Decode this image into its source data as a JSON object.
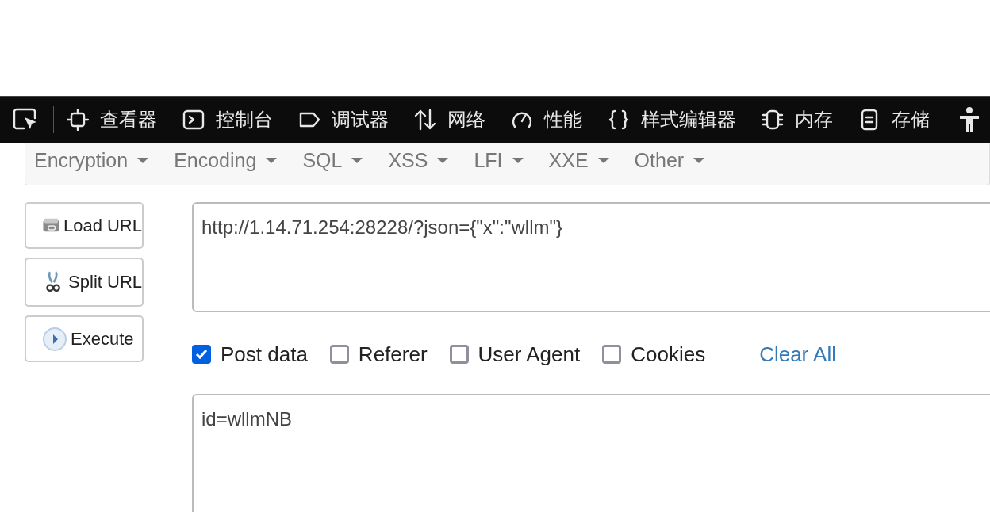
{
  "devtools": {
    "tabs": [
      {
        "label": "查看器"
      },
      {
        "label": "控制台"
      },
      {
        "label": "调试器"
      },
      {
        "label": "网络"
      },
      {
        "label": "性能"
      },
      {
        "label": "样式编辑器"
      },
      {
        "label": "内存"
      },
      {
        "label": "存储"
      }
    ]
  },
  "menu": [
    {
      "label": "Encryption"
    },
    {
      "label": "Encoding"
    },
    {
      "label": "SQL"
    },
    {
      "label": "XSS"
    },
    {
      "label": "LFI"
    },
    {
      "label": "XXE"
    },
    {
      "label": "Other"
    }
  ],
  "buttons": [
    {
      "label": "Load URL"
    },
    {
      "label": "Split URL"
    },
    {
      "label": "Execute"
    }
  ],
  "url": {
    "value": "http://1.14.71.254:28228/?json={\"x\":\"wllm\"}"
  },
  "options": [
    {
      "label": "Post data",
      "checked": true
    },
    {
      "label": "Referer",
      "checked": false
    },
    {
      "label": "User Agent",
      "checked": false
    },
    {
      "label": "Cookies",
      "checked": false
    }
  ],
  "clear_all": "Clear All",
  "post_body": {
    "value": "id=wllmNB"
  }
}
